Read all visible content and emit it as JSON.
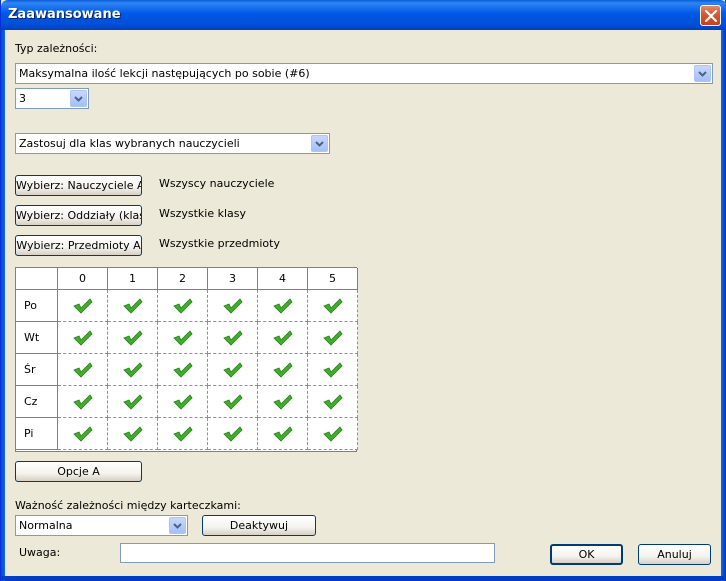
{
  "window": {
    "title": "Zaawansowane"
  },
  "dependency_type": {
    "label": "Typ zależności:",
    "selected": "Maksymalna ilość lekcji następujących po sobie (#6)",
    "count_selected": "3"
  },
  "apply_scope": {
    "selected": "Zastosuj dla klas wybranych nauczycieli"
  },
  "selectors": [
    {
      "button": "Wybierz: Nauczyciele A",
      "value": "Wszyscy nauczyciele"
    },
    {
      "button": "Wybierz: Oddziały (klasy) A",
      "value": "Wszystkie klasy"
    },
    {
      "button": "Wybierz: Przedmioty A",
      "value": "Wszystkie przedmioty"
    }
  ],
  "schedule_grid": {
    "columns": [
      "0",
      "1",
      "2",
      "3",
      "4",
      "5"
    ],
    "rows": [
      "Po",
      "Wt",
      "Śr",
      "Cz",
      "Pi"
    ],
    "all_checked": true,
    "check_color": "#3fae2a"
  },
  "options_button": "Opcje A",
  "importance": {
    "label": "Ważność zależności między karteczkami:",
    "selected": "Normalna",
    "deactivate": "Deaktywuj"
  },
  "note": {
    "label": "Uwaga:",
    "value": ""
  },
  "footer": {
    "ok": "OK",
    "cancel": "Anuluj"
  }
}
